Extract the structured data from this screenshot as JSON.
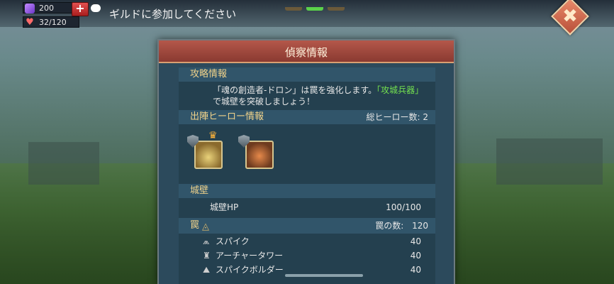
{
  "topbar": {
    "gems": "200",
    "plus_label": "+",
    "stamina": "32/120",
    "guild_prompt": "ギルドに参加してください",
    "close_label": "✖"
  },
  "panel": {
    "title": "偵察情報",
    "strategy": {
      "heading": "攻略情報",
      "line1_a": "「魂の創造者-ドロン」は罠を強化します。",
      "line1_b": "「攻城兵器」",
      "line2": "で城壁を突破しましょう！"
    },
    "heroes": {
      "heading": "出陣ヒーロー情報",
      "total_label": "総ヒーロー数: 2"
    },
    "wall": {
      "heading": "城壁",
      "hp_label": "城壁HP",
      "hp_value": "100/100"
    },
    "traps": {
      "heading": "罠",
      "count_label": "罠の数:",
      "count_value": "120",
      "items": [
        {
          "label": "スパイク",
          "value": "40"
        },
        {
          "label": "アーチャータワー",
          "value": "40"
        },
        {
          "label": "スパイクボルダー",
          "value": "40"
        }
      ]
    }
  },
  "colors": {
    "accent_green": "#73e04f",
    "header_red": "#b4584a",
    "section_gold": "#f0d28a"
  },
  "icons": [
    "gem-icon",
    "heart-icon",
    "plus-icon",
    "guild-icon",
    "close-icon",
    "shield-icon",
    "crown-icon",
    "eye-icon",
    "spike-icon",
    "tower-icon",
    "boulder-icon"
  ]
}
